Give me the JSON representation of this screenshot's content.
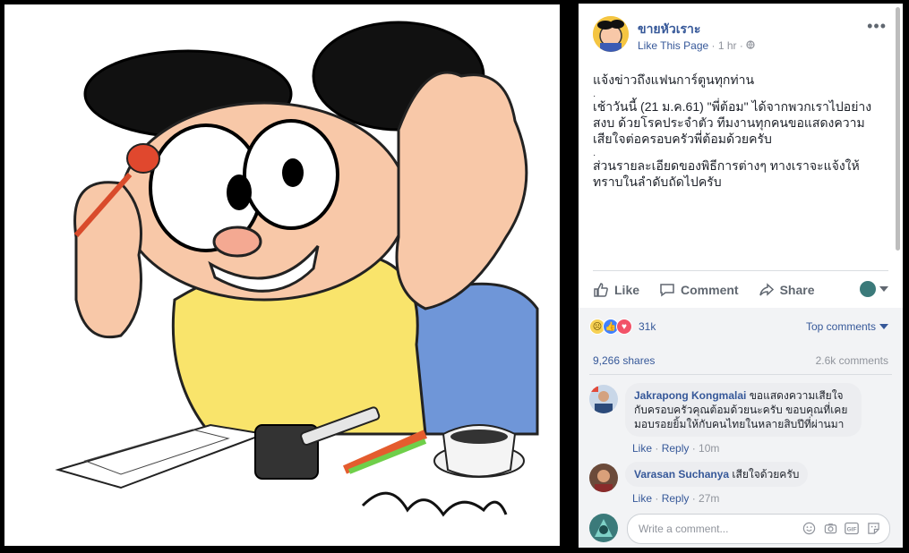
{
  "post": {
    "page_name": "ขายหัวเราะ",
    "like_page": "Like This Page",
    "separator": " · ",
    "time": "1 hr",
    "separator2": " · ",
    "privacy_icon": "globe-icon",
    "paragraphs": [
      "แจ้งข่าวถึงแฟนการ์ตูนทุกท่าน",
      "เช้าวันนี้ (21 ม.ค.61) \"พี่ต้อม\" ได้จากพวกเราไปอย่างสงบ ด้วยโรคประจำตัว ทีมงานทุกคนขอแสดงความเสียใจต่อครอบครัวพี่ต้อมด้วยครับ",
      "ส่วนรายละเอียดของพิธีการต่างๆ ทางเราจะแจ้งให้ทราบในลำดับถัดไปครับ"
    ],
    "dots": [
      "·",
      "·"
    ]
  },
  "actions": {
    "like": "Like",
    "comment": "Comment",
    "share": "Share"
  },
  "feedback": {
    "reaction_count": "31k",
    "reaction_icons": [
      "sad-reaction-icon",
      "like-reaction-icon",
      "love-reaction-icon"
    ],
    "top_comments": "Top comments",
    "shares": "9,266 shares",
    "comments": "2.6k comments"
  },
  "comments": [
    {
      "author": "Jakrapong Kongmalai",
      "text": " ขอแสดงความเสียใจกับครอบครัวคุณต้อมด้วยนะครับ ขอบคุณที่เคยมอบรอยยิ้มให้กับคนไทยในหลายสิบปีที่ผ่านมา",
      "like": "Like",
      "reply": "Reply",
      "sep": " · ",
      "sep2": " · ",
      "time": "10m"
    },
    {
      "author": "Varasan Suchanya",
      "text": " เสียใจด้วยครับ",
      "like": "Like",
      "reply": "Reply",
      "sep": " · ",
      "sep2": " · ",
      "time": "27m"
    }
  ],
  "composer": {
    "placeholder": "Write a comment...",
    "icons": [
      "emoji-icon",
      "camera-icon",
      "gif-icon",
      "sticker-icon"
    ],
    "gif_label": "GIF"
  },
  "colors": {
    "link": "#365899",
    "muted": "#90949c",
    "panel_bg": "#ffffff",
    "feedback_bg": "#f2f3f5"
  }
}
